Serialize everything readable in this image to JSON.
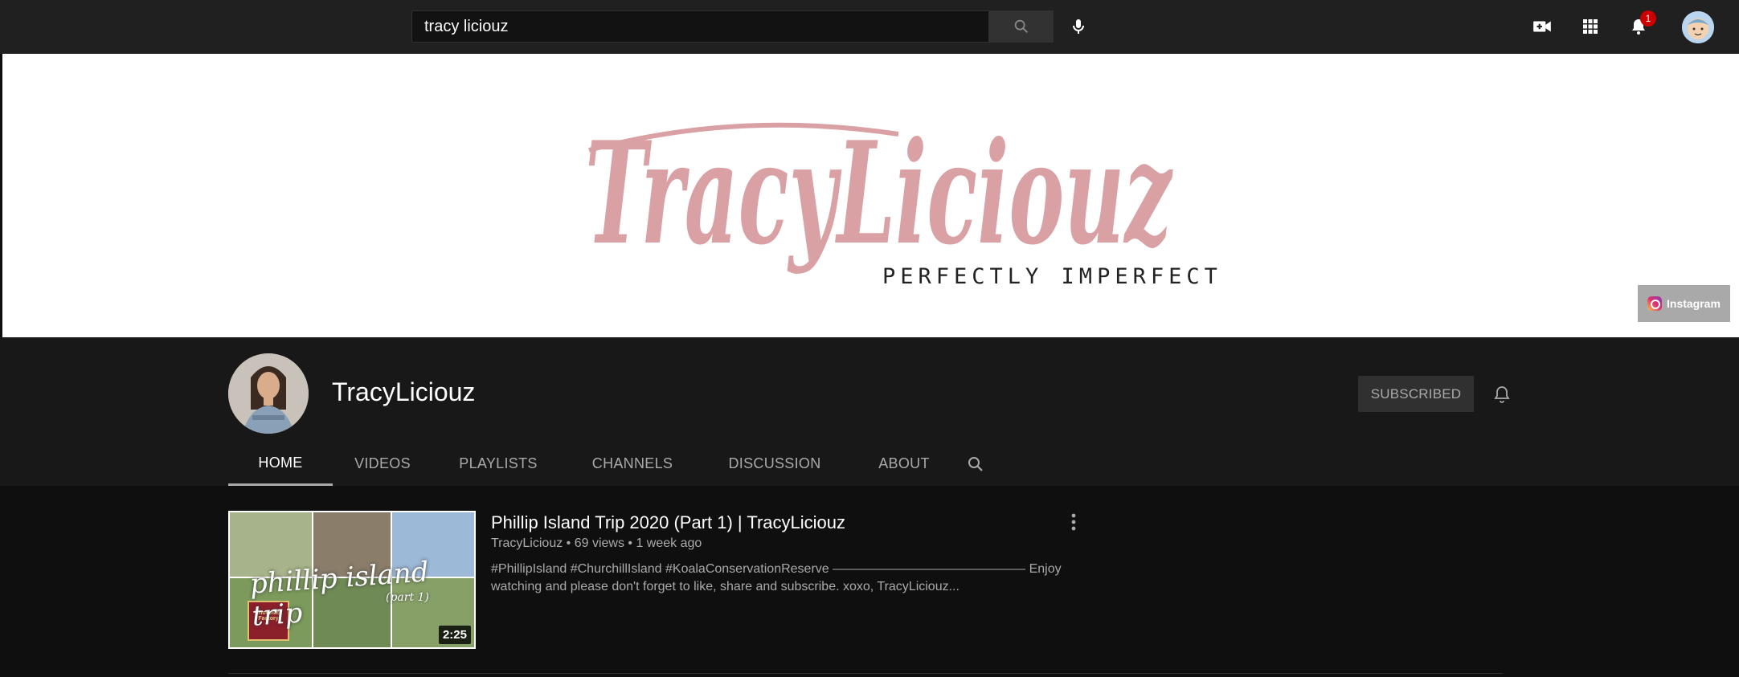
{
  "search": {
    "value": "tracy liciouz",
    "button_icon": "search-icon",
    "mic_icon": "microphone-icon"
  },
  "topbar": {
    "create_icon": "create-video-icon",
    "apps_icon": "apps-grid-icon",
    "notifications_icon": "bell-icon",
    "notifications_count": "1",
    "account_icon": "account-avatar"
  },
  "banner": {
    "logo_text": "TracyLiciouz",
    "tagline": "PERFECTLY IMPERFECT",
    "logo_color": "#d9a1a4",
    "link_label": "Instagram"
  },
  "channel": {
    "name": "TracyLiciouz",
    "subscribe_label": "SUBSCRIBED",
    "tabs": [
      {
        "label": "HOME"
      },
      {
        "label": "VIDEOS"
      },
      {
        "label": "PLAYLISTS"
      },
      {
        "label": "CHANNELS"
      },
      {
        "label": "DISCUSSION"
      },
      {
        "label": "ABOUT"
      }
    ]
  },
  "video": {
    "title": "Phillip Island Trip 2020 (Part 1) | TracyLiciouz",
    "meta": "TracyLiciouz • 69 views • 1 week ago",
    "description": "#PhillipIsland #ChurchillIsland #KoalaConservationReserve ——————————————— Enjoy watching and please don't forget to like, share and subscribe. xoxo, TracyLiciouz...",
    "duration": "2:25",
    "thumb_title": "phillip island trip",
    "thumb_sub": "(part 1)",
    "thumb_sign": "Chocolate Factory"
  },
  "colors": {
    "background": "#0f0f0f",
    "topbar": "#202020",
    "header": "#181818",
    "badge": "#cc0000"
  }
}
